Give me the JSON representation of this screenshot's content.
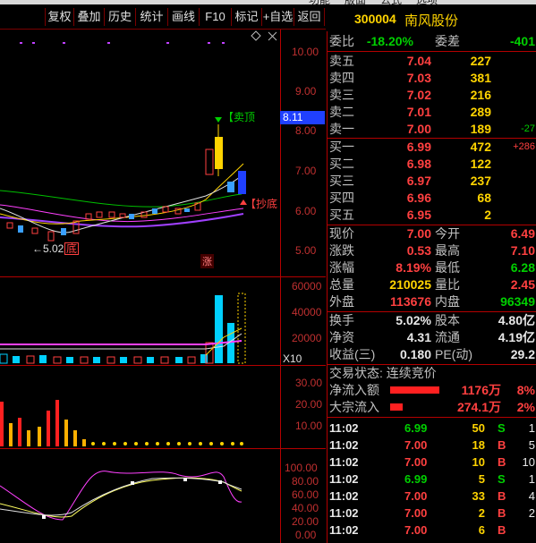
{
  "menu": [
    "功能",
    "版面",
    "公式",
    "选项"
  ],
  "toolbar": {
    "buttons": [
      "复权",
      "叠加",
      "历史",
      "统计",
      "画线",
      "F10",
      "标记",
      "+自选",
      "返回"
    ]
  },
  "stock": {
    "code": "300004",
    "name": "南风股份"
  },
  "price_axis": [
    "10.00",
    "9.00",
    "8.00",
    "7.00",
    "6.00",
    "5.00"
  ],
  "current_price_label": "8.11",
  "annotations": {
    "sell_top": "【卖顶",
    "buy_bottom": "【抄底",
    "low_price": "5.02",
    "low_tag": "底",
    "up_tag": "涨"
  },
  "volume_axis": [
    "60000",
    "40000",
    "20000"
  ],
  "volume_unit": "X10",
  "indicator1_axis": [
    "30.00",
    "20.00",
    "10.00"
  ],
  "indicator2_axis": [
    "100.00",
    "80.00",
    "60.00",
    "40.00",
    "20.00",
    "0.00"
  ],
  "committee": {
    "ratio_label": "委比",
    "ratio_value": "-18.20%",
    "diff_label": "委差",
    "diff_value": "-401"
  },
  "asks": [
    {
      "label": "卖五",
      "price": "7.04",
      "vol": "227",
      "chg": ""
    },
    {
      "label": "卖四",
      "price": "7.03",
      "vol": "381",
      "chg": ""
    },
    {
      "label": "卖三",
      "price": "7.02",
      "vol": "216",
      "chg": ""
    },
    {
      "label": "卖二",
      "price": "7.01",
      "vol": "289",
      "chg": ""
    },
    {
      "label": "卖一",
      "price": "7.00",
      "vol": "189",
      "chg": "-27"
    }
  ],
  "bids": [
    {
      "label": "买一",
      "price": "6.99",
      "vol": "472",
      "chg": "+286"
    },
    {
      "label": "买二",
      "price": "6.98",
      "vol": "122",
      "chg": ""
    },
    {
      "label": "买三",
      "price": "6.97",
      "vol": "237",
      "chg": ""
    },
    {
      "label": "买四",
      "price": "6.96",
      "vol": "68",
      "chg": ""
    },
    {
      "label": "买五",
      "price": "6.95",
      "vol": "2",
      "chg": ""
    }
  ],
  "quote": [
    {
      "l1": "现价",
      "v1": "7.00",
      "l2": "今开",
      "v2": "6.49"
    },
    {
      "l1": "涨跌",
      "v1": "0.53",
      "l2": "最高",
      "v2": "7.10"
    },
    {
      "l1": "涨幅",
      "v1": "8.19%",
      "l2": "最低",
      "v2": "6.28"
    },
    {
      "l1": "总量",
      "v1": "210025",
      "l2": "量比",
      "v2": "2.45"
    },
    {
      "l1": "外盘",
      "v1": "113676",
      "l2": "内盘",
      "v2": "96349"
    }
  ],
  "fundamentals": [
    {
      "l1": "换手",
      "v1": "5.02%",
      "l2": "股本",
      "v2": "4.80亿"
    },
    {
      "l1": "净资",
      "v1": "4.31",
      "l2": "流通",
      "v2": "4.19亿"
    },
    {
      "l1": "收益(三)",
      "v1": "0.180",
      "l2": "PE(动)",
      "v2": "29.2"
    }
  ],
  "trade_status": "交易状态: 连续竞价",
  "flows": [
    {
      "label": "净流入额",
      "amount": "1176万",
      "pct": "8%"
    },
    {
      "label": "大宗流入",
      "amount": "274.1万",
      "pct": "2%"
    }
  ],
  "ticks": [
    {
      "time": "11:02",
      "price": "6.99",
      "vol": "50",
      "side": "S",
      "n": "1"
    },
    {
      "time": "11:02",
      "price": "7.00",
      "vol": "18",
      "side": "B",
      "n": "5"
    },
    {
      "time": "11:02",
      "price": "7.00",
      "vol": "10",
      "side": "B",
      "n": "10"
    },
    {
      "time": "11:02",
      "price": "6.99",
      "vol": "5",
      "side": "S",
      "n": "1"
    },
    {
      "time": "11:02",
      "price": "7.00",
      "vol": "33",
      "side": "B",
      "n": "4"
    },
    {
      "time": "11:02",
      "price": "7.00",
      "vol": "2",
      "side": "B",
      "n": "2"
    },
    {
      "time": "11:02",
      "price": "7.00",
      "vol": "6",
      "side": "B",
      "n": ""
    }
  ],
  "colors": {
    "up": "#ff4040",
    "down": "#00d000",
    "accent": "#ffd400",
    "axis": "#b40000"
  }
}
